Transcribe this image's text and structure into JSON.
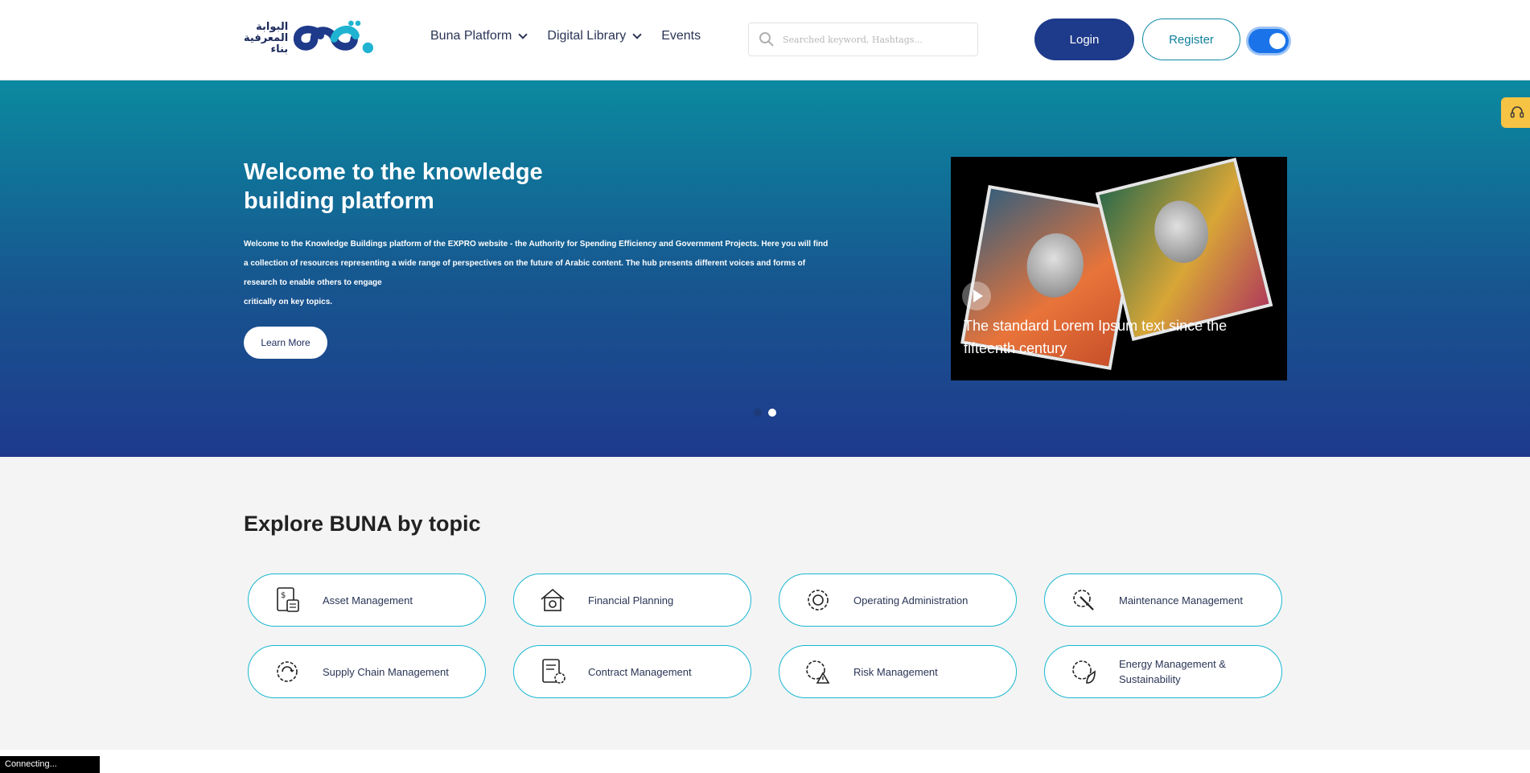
{
  "header": {
    "logo_arabic_line1": "البوابة",
    "logo_arabic_line2": "المعرفية",
    "logo_arabic_line3": "بناء",
    "nav": [
      {
        "label": "Buna Platform",
        "has_dropdown": true
      },
      {
        "label": "Digital Library",
        "has_dropdown": true
      },
      {
        "label": "Events",
        "has_dropdown": false
      }
    ],
    "search_placeholder": "Searched keyword, Hashtags...",
    "login_label": "Login",
    "register_label": "Register",
    "toggle_on": true
  },
  "hero": {
    "title": "Welcome to the knowledge building platform",
    "description": "Welcome to the Knowledge Buildings platform of the EXPRO website - the Authority for Spending Efficiency and Government Projects. Here you will find a collection of resources representing a wide range of perspectives on the future of Arabic content. The hub presents different voices and forms of research to enable others to engage\ncritically on key topics.",
    "learn_more_label": "Learn More",
    "video_caption": "The standard Lorem Ipsum text since the fifteenth century",
    "slides": 2,
    "active_slide": 2
  },
  "topics": {
    "title": "Explore BUNA by topic",
    "items": [
      {
        "label": "Asset Management",
        "icon": "asset-document-icon"
      },
      {
        "label": "Financial Planning",
        "icon": "finance-house-gear-icon"
      },
      {
        "label": "Operating Administration",
        "icon": "operations-gear-icon"
      },
      {
        "label": "Maintenance Management",
        "icon": "maintenance-wrench-gear-icon"
      },
      {
        "label": "Supply Chain Management",
        "icon": "supply-chain-gear-icon"
      },
      {
        "label": "Contract Management",
        "icon": "contract-document-icon"
      },
      {
        "label": "Risk Management",
        "icon": "risk-gear-warning-icon"
      },
      {
        "label": "Energy Management & Sustainability",
        "icon": "energy-leaf-gear-icon"
      }
    ]
  },
  "status_bar": "Connecting...",
  "colors": {
    "primary": "#1e3a8a",
    "accent": "#0f8aa6",
    "topic_border": "#19b7d0",
    "support_button": "#f6c344"
  }
}
